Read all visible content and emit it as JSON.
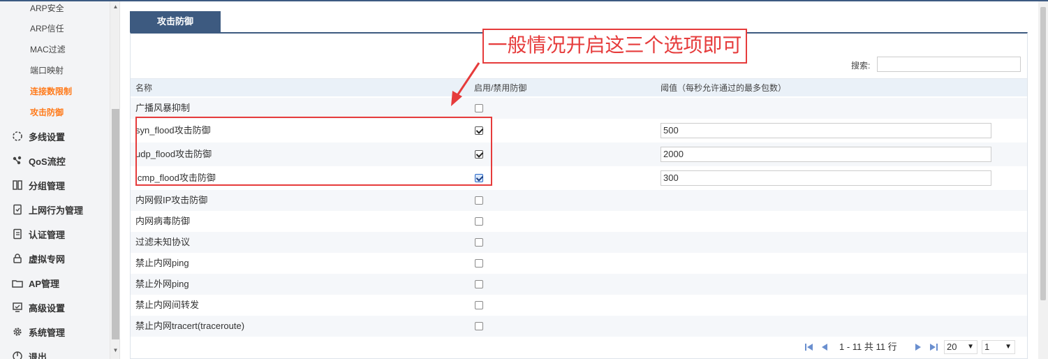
{
  "sidebar": {
    "sub_items": [
      {
        "label": "ARP安全",
        "active": false
      },
      {
        "label": "ARP信任",
        "active": false
      },
      {
        "label": "MAC过滤",
        "active": false
      },
      {
        "label": "端口映射",
        "active": false
      },
      {
        "label": "连接数限制",
        "active": true
      },
      {
        "label": "攻击防御",
        "active": true
      }
    ],
    "menu_items": [
      {
        "label": "多线设置",
        "icon": "multiline-icon"
      },
      {
        "label": "QoS流控",
        "icon": "qos-icon"
      },
      {
        "label": "分组管理",
        "icon": "group-icon"
      },
      {
        "label": "上网行为管理",
        "icon": "behavior-icon"
      },
      {
        "label": "认证管理",
        "icon": "auth-icon"
      },
      {
        "label": "虚拟专网",
        "icon": "vpn-icon"
      },
      {
        "label": "AP管理",
        "icon": "ap-icon"
      },
      {
        "label": "高级设置",
        "icon": "advanced-icon"
      },
      {
        "label": "系统管理",
        "icon": "gear-icon"
      },
      {
        "label": "退出",
        "icon": "logout-icon"
      }
    ]
  },
  "tab": {
    "label": "攻击防御"
  },
  "search": {
    "label": "搜索:",
    "value": ""
  },
  "table": {
    "headers": {
      "name": "名称",
      "enable": "启用/禁用防御",
      "threshold": "阈值（每秒允许通过的最多包数）"
    },
    "rows": [
      {
        "name": "广播风暴抑制",
        "checked": false,
        "threshold": null
      },
      {
        "name": "syn_flood攻击防御",
        "checked": true,
        "threshold": "500"
      },
      {
        "name": "udp_flood攻击防御",
        "checked": true,
        "threshold": "2000"
      },
      {
        "name": "icmp_flood攻击防御",
        "checked": true,
        "threshold": "300"
      },
      {
        "name": "内网假IP攻击防御",
        "checked": false,
        "threshold": null
      },
      {
        "name": "内网病毒防御",
        "checked": false,
        "threshold": null
      },
      {
        "name": "过滤未知协议",
        "checked": false,
        "threshold": null
      },
      {
        "name": "禁止内网ping",
        "checked": false,
        "threshold": null
      },
      {
        "name": "禁止外网ping",
        "checked": false,
        "threshold": null
      },
      {
        "name": "禁止内网间转发",
        "checked": false,
        "threshold": null
      },
      {
        "name": "禁止内网tracert(traceroute)",
        "checked": false,
        "threshold": null
      }
    ]
  },
  "pager": {
    "summary": "1 - 11 共 11 行",
    "page_size": "20",
    "page": "1"
  },
  "annotation": {
    "callout": "一般情况开启这三个选项即可",
    "color": "#e63b3b"
  },
  "colors": {
    "accent": "#3d5a80",
    "active_menu": "#ff7a1a",
    "header_bg": "#eaf1f8"
  }
}
